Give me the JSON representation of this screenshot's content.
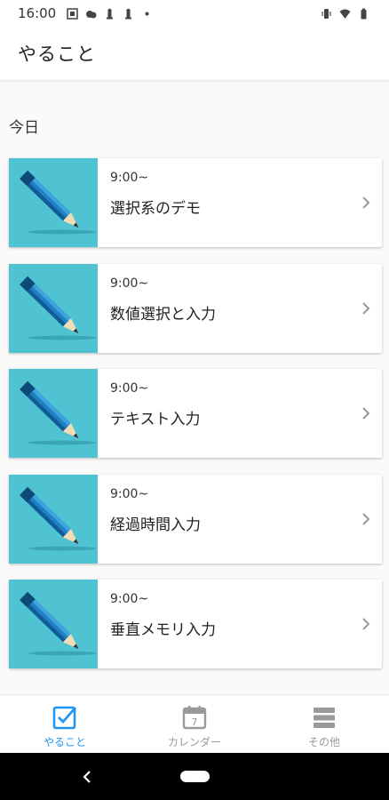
{
  "status_bar": {
    "time": "16:00"
  },
  "app_bar": {
    "title": "やること"
  },
  "section": {
    "header": "今日"
  },
  "tasks": [
    {
      "time": "9:00~",
      "title": "選択系のデモ"
    },
    {
      "time": "9:00~",
      "title": "数値選択と入力"
    },
    {
      "time": "9:00~",
      "title": "テキスト入力"
    },
    {
      "time": "9:00~",
      "title": "経過時間入力"
    },
    {
      "time": "9:00~",
      "title": "垂直メモリ入力"
    }
  ],
  "bottom_nav": {
    "items": [
      {
        "label": "やること",
        "icon": "checkbox-icon",
        "active": true
      },
      {
        "label": "カレンダー",
        "icon": "calendar-icon",
        "active": false,
        "calendar_day": "7"
      },
      {
        "label": "その他",
        "icon": "menu-icon",
        "active": false
      }
    ]
  },
  "colors": {
    "accent": "#2196f3",
    "thumbnail_bg": "#4fc3d2",
    "inactive_nav": "#999999"
  }
}
